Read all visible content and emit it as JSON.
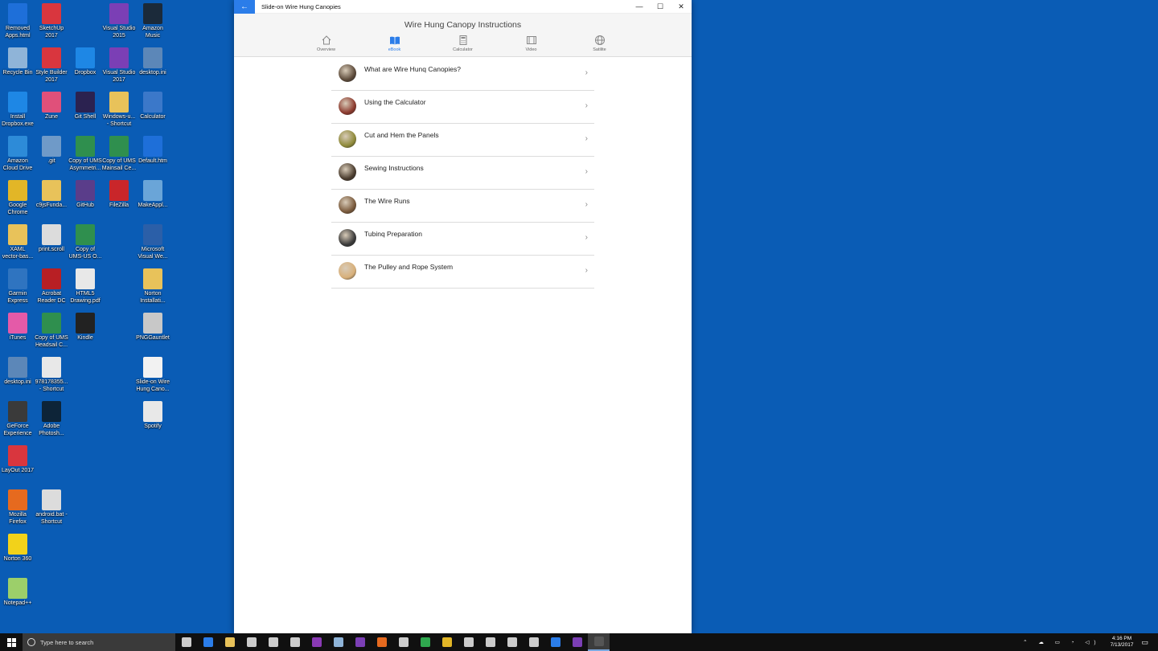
{
  "desktop_icons": [
    {
      "label": "Removed\nApps.html",
      "color": "#1e6fd9",
      "col": 0,
      "row": 0
    },
    {
      "label": "SketchUp\n2017",
      "color": "#d9363e",
      "col": 1,
      "row": 0
    },
    {
      "label": "Visual Studio\n2015",
      "color": "#7b3fb5",
      "col": 3,
      "row": 0
    },
    {
      "label": "Amazon\nMusic",
      "color": "#1b2a3a",
      "col": 4,
      "row": 0
    },
    {
      "label": "Recycle Bin",
      "color": "#8fb4d8",
      "col": 0,
      "row": 1
    },
    {
      "label": "Style Builder\n2017",
      "color": "#d9363e",
      "col": 1,
      "row": 1
    },
    {
      "label": "Dropbox",
      "color": "#1e87e5",
      "col": 2,
      "row": 1
    },
    {
      "label": "Visual Studio\n2017",
      "color": "#7b3fb5",
      "col": 3,
      "row": 1
    },
    {
      "label": "desktop.ini",
      "color": "#5c87b8",
      "col": 4,
      "row": 1
    },
    {
      "label": "Install\nDropbox.exe",
      "color": "#1e87e5",
      "col": 0,
      "row": 2
    },
    {
      "label": "Zune",
      "color": "#e0507a",
      "col": 1,
      "row": 2
    },
    {
      "label": "Git Shell",
      "color": "#2b2250",
      "col": 2,
      "row": 2
    },
    {
      "label": "Windows-u...\n- Shortcut",
      "color": "#e8c25a",
      "col": 3,
      "row": 2
    },
    {
      "label": "Calculator",
      "color": "#3b78c9",
      "col": 4,
      "row": 2
    },
    {
      "label": "Amazon\nCloud Drive",
      "color": "#2d8bd8",
      "col": 0,
      "row": 3
    },
    {
      "label": ".git",
      "color": "#6f9ac8",
      "col": 1,
      "row": 3
    },
    {
      "label": "Copy of UMS\nAsymmetri...",
      "color": "#2f8f4e",
      "col": 2,
      "row": 3
    },
    {
      "label": "Copy of UMS\nMainsail Ce...",
      "color": "#2f8f4e",
      "col": 3,
      "row": 3
    },
    {
      "label": "Default.htm",
      "color": "#1e6fd9",
      "col": 4,
      "row": 3
    },
    {
      "label": "Google\nChrome",
      "color": "#e2b627",
      "col": 0,
      "row": 4
    },
    {
      "label": "c9jsFunda...",
      "color": "#e8c25a",
      "col": 1,
      "row": 4
    },
    {
      "label": "GitHub",
      "color": "#5a3d8a",
      "col": 2,
      "row": 4
    },
    {
      "label": "FileZilla",
      "color": "#c9262a",
      "col": 3,
      "row": 4
    },
    {
      "label": "MakeAppl...",
      "color": "#6aa5d8",
      "col": 4,
      "row": 4
    },
    {
      "label": "XAML\nvector-bas...",
      "color": "#e8c25a",
      "col": 0,
      "row": 5
    },
    {
      "label": "print.scroll",
      "color": "#dcdcdc",
      "col": 1,
      "row": 5
    },
    {
      "label": "Copy of\nUMS-US O...",
      "color": "#2f8f4e",
      "col": 2,
      "row": 5
    },
    {
      "label": "Microsoft\nVisual We...",
      "color": "#2b5fa8",
      "col": 4,
      "row": 5
    },
    {
      "label": "Garmin\nExpress",
      "color": "#2f74c0",
      "col": 0,
      "row": 6
    },
    {
      "label": "Acrobat\nReader DC",
      "color": "#b81f24",
      "col": 1,
      "row": 6
    },
    {
      "label": "HTML5\nDrawing.pdf",
      "color": "#e8e8e8",
      "col": 2,
      "row": 6
    },
    {
      "label": "Norton\nInstallati...",
      "color": "#e8c25a",
      "col": 4,
      "row": 6
    },
    {
      "label": "iTunes",
      "color": "#e45aa8",
      "col": 0,
      "row": 7
    },
    {
      "label": "Copy of UMS\nHeadsail C...",
      "color": "#2f8f4e",
      "col": 1,
      "row": 7
    },
    {
      "label": "Kindle",
      "color": "#222222",
      "col": 2,
      "row": 7
    },
    {
      "label": "PNGGauntlet",
      "color": "#c8c8c8",
      "col": 4,
      "row": 7
    },
    {
      "label": "desktop.ini",
      "color": "#5c87b8",
      "col": 0,
      "row": 8
    },
    {
      "label": "978178355...\n- Shortcut",
      "color": "#e8e8e8",
      "col": 1,
      "row": 8
    },
    {
      "label": "Slide-on Wire\nHung Cano...",
      "color": "#f2f2f2",
      "col": 4,
      "row": 8
    },
    {
      "label": "GeForce\nExperience",
      "color": "#3a3a3a",
      "col": 0,
      "row": 9
    },
    {
      "label": "Adobe\nPhotosh...",
      "color": "#0d2438",
      "col": 1,
      "row": 9
    },
    {
      "label": "Spotify",
      "color": "#e8e8e8",
      "col": 4,
      "row": 9
    },
    {
      "label": "LayOut 2017",
      "color": "#d9363e",
      "col": 0,
      "row": 10
    },
    {
      "label": "Mozilla\nFirefox",
      "color": "#e66a1f",
      "col": 0,
      "row": 11
    },
    {
      "label": "android.bat -\nShortcut",
      "color": "#dcdcdc",
      "col": 1,
      "row": 11
    },
    {
      "label": "Norton 360",
      "color": "#f2d21a",
      "col": 0,
      "row": 12
    },
    {
      "label": "Notepad++",
      "color": "#9ccf6a",
      "col": 0,
      "row": 13
    }
  ],
  "window": {
    "app_title": "Slide-on Wire Hung Canopies",
    "back_glyph": "←",
    "minimize_glyph": "—",
    "maximize_glyph": "☐",
    "close_glyph": "✕",
    "page_title": "Wire Hung Canopy Instructions",
    "tabs": [
      {
        "label": "Overview",
        "icon": "home-icon",
        "active": false
      },
      {
        "label": "eBook",
        "icon": "book-icon",
        "active": true
      },
      {
        "label": "Calculator",
        "icon": "calculator-icon",
        "active": false
      },
      {
        "label": "Video",
        "icon": "film-icon",
        "active": false
      },
      {
        "label": "Satilite",
        "icon": "globe-icon",
        "active": false
      }
    ],
    "accent_color": "#2b7de9",
    "items": [
      {
        "title": "What are Wire Hunq Canopies?",
        "thumb_color": "#5c4a3a"
      },
      {
        "title": "Using the Calculator",
        "thumb_color": "#8c3a2e"
      },
      {
        "title": "Cut and Hem the Panels",
        "thumb_color": "#8f8a3a"
      },
      {
        "title": "Sewing Instructions",
        "thumb_color": "#4a3c2e"
      },
      {
        "title": "The Wire Runs",
        "thumb_color": "#7a5a3c"
      },
      {
        "title": "Tubinq Preparation",
        "thumb_color": "#3a3a3a"
      },
      {
        "title": "The Pulley and Rope System",
        "thumb_color": "#d8b07a"
      }
    ],
    "chevron": "›"
  },
  "taskbar": {
    "search_placeholder": "Type here to search",
    "icons": [
      "task-view-icon",
      "edge-icon",
      "file-explorer-icon",
      "store-icon",
      "mail-icon",
      "groove-icon",
      "onenote-icon",
      "app-icon",
      "visual-studio-icon",
      "firefox-icon",
      "media-icon",
      "chrome-ext-icon",
      "chrome-icon",
      "calculator-icon",
      "app2-icon",
      "app3-icon",
      "app4-icon",
      "app5-icon",
      "visual-studio-2-icon",
      "active-app-icon"
    ],
    "icon_colors": [
      "#cccccc",
      "#2b7de9",
      "#e8c25a",
      "#cccccc",
      "#cccccc",
      "#cccccc",
      "#8a3ab5",
      "#8fb4d8",
      "#7b3fb5",
      "#e66a1f",
      "#cccccc",
      "#2fa84f",
      "#e2b627",
      "#cccccc",
      "#cccccc",
      "#cccccc",
      "#cccccc",
      "#2b7de9",
      "#7b3fb5",
      "#555555"
    ],
    "time": "4:16 PM",
    "date": "7/13/2017"
  }
}
